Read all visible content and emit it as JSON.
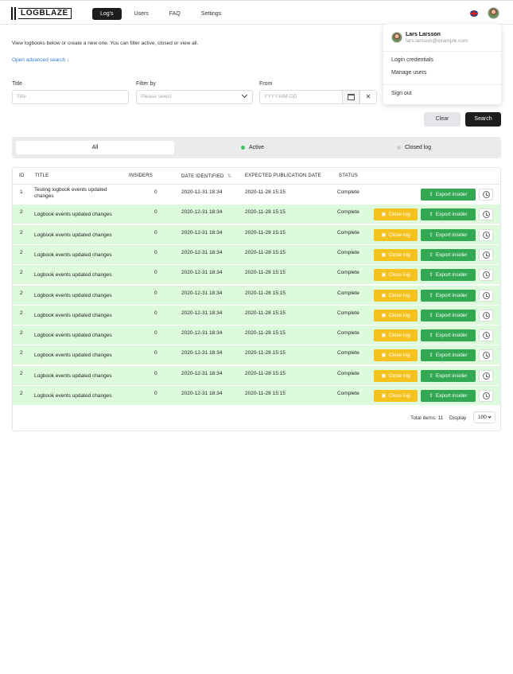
{
  "header": {
    "logo_text": "LOGBLAZE",
    "nav": [
      "Log's",
      "Users",
      "FAQ",
      "Settings"
    ]
  },
  "user_menu": {
    "name": "Lars Larsson",
    "email": "lars.larsson@example.com",
    "items": [
      "Login credentials",
      "Manage users"
    ],
    "signout": "Sign out"
  },
  "intro": "View logbooks below or create a new one. You can filter active, closed or view all.",
  "advanced_search": "Open advanced search ↓",
  "filters": {
    "title_label": "Title",
    "title_placeholder": "Title",
    "filterby_label": "Filter by",
    "filterby_placeholder": "Please select",
    "from_label": "From",
    "from_placeholder": "YYYY-MM-DD",
    "clear_symbol": "✕"
  },
  "actions": {
    "clear": "Clear",
    "search": "Search"
  },
  "segments": {
    "all": "All",
    "active": "Active",
    "closed": "Closed log"
  },
  "table": {
    "columns": [
      "ID",
      "TITLE",
      "INSIDERS",
      "DATE IDENTIFIED",
      "EXPECTED PUBLICATION DATE",
      "STATUS"
    ],
    "sort_icon": "⇅",
    "close_label": "Close log",
    "export_label": "Export insider",
    "rows": [
      {
        "id": "1",
        "title": "Testing logbook events updated changes",
        "insiders": "0",
        "date": "2020-12-31 18:34",
        "pub": "2020-11-28 15:15",
        "status": "Complete"
      },
      {
        "id": "2",
        "title": "Logbook events updated changes",
        "insiders": "0",
        "date": "2020-12-31 18:34",
        "pub": "2020-11-28 15:15",
        "status": "Complete"
      },
      {
        "id": "2",
        "title": "Logbook events updated changes",
        "insiders": "0",
        "date": "2020-12-31 18:34",
        "pub": "2020-11-28 15:15",
        "status": "Complete"
      },
      {
        "id": "2",
        "title": "Logbook events updated changes",
        "insiders": "0",
        "date": "2020-12-31 18:34",
        "pub": "2020-11-28 15:15",
        "status": "Complete"
      },
      {
        "id": "2",
        "title": "Logbook events updated changes",
        "insiders": "0",
        "date": "2020-12-31 18:34",
        "pub": "2020-11-28 15:15",
        "status": "Complete"
      },
      {
        "id": "2",
        "title": "Logbook events updated changes",
        "insiders": "0",
        "date": "2020-12-31 18:34",
        "pub": "2020-11-28 15:15",
        "status": "Complete"
      },
      {
        "id": "2",
        "title": "Logbook events updated changes",
        "insiders": "0",
        "date": "2020-12-31 18:34",
        "pub": "2020-11-28 15:15",
        "status": "Complete"
      },
      {
        "id": "2",
        "title": "Logbook events updated changes",
        "insiders": "0",
        "date": "2020-12-31 18:34",
        "pub": "2020-11-28 15:15",
        "status": "Complete"
      },
      {
        "id": "2",
        "title": "Logbook events updated changes",
        "insiders": "0",
        "date": "2020-12-31 18:34",
        "pub": "2020-11-28 15:15",
        "status": "Complete"
      },
      {
        "id": "2",
        "title": "Logbook events updated changes",
        "insiders": "0",
        "date": "2020-12-31 18:34",
        "pub": "2020-11-28 15:15",
        "status": "Complete"
      },
      {
        "id": "2",
        "title": "Logbook events updated changes",
        "insiders": "0",
        "date": "2020-12-31 18:34",
        "pub": "2020-11-28 15:15",
        "status": "Complete"
      }
    ]
  },
  "footer": {
    "total": "Total items: 11",
    "display_label": "Display",
    "display_value": "100"
  },
  "colors": {
    "active_green": "#3cc45a",
    "row_green": "#ddfadd",
    "close_yellow": "#f5c11c",
    "export_green": "#33a852",
    "link_blue": "#2f7bd8"
  }
}
